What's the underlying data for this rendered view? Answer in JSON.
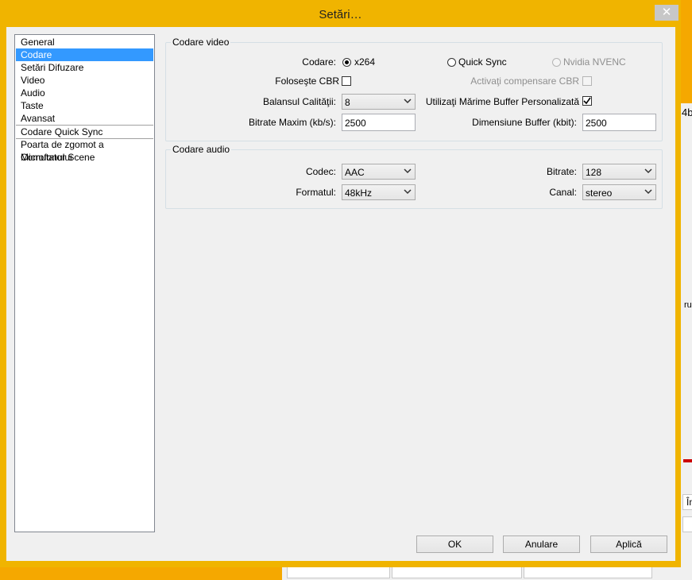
{
  "window": {
    "title": "Setări…",
    "close_glyph": "✕"
  },
  "nav": {
    "items": [
      {
        "label": "General"
      },
      {
        "label": "Codare"
      },
      {
        "label": "Setări Difuzare"
      },
      {
        "label": "Video"
      },
      {
        "label": "Audio"
      },
      {
        "label": "Taste"
      },
      {
        "label": "Avansat"
      },
      {
        "label": "Codare Quick Sync"
      },
      {
        "label": "Poarta de zgomot a Microfonului"
      },
      {
        "label": "Comutator Scene"
      }
    ],
    "selected": "Codare"
  },
  "video": {
    "title": "Codare video",
    "encoder_label": "Codare:",
    "encoder_options": [
      {
        "label": "x264",
        "checked": true,
        "enabled": true
      },
      {
        "label": "Quick Sync",
        "checked": false,
        "enabled": true
      },
      {
        "label": "Nvidia NVENC",
        "checked": false,
        "enabled": false
      }
    ],
    "cbr_label": "Foloseşte CBR",
    "cbr_checked": false,
    "padding_label": "Activaţi compensare CBR",
    "padding_checked": false,
    "quality_label": "Balansul Calităţii:",
    "quality_value": "8",
    "custom_buffer_label": "Utilizaţi Mărime Buffer Personalizată",
    "custom_buffer_checked": true,
    "max_bitrate_label": "Bitrate Maxim (kb/s):",
    "max_bitrate_value": "2500",
    "buffer_size_label": "Dimensiune Buffer (kbit):",
    "buffer_size_value": "2500"
  },
  "audio": {
    "title": "Codare audio",
    "codec_label": "Codec:",
    "codec_value": "AAC",
    "bitrate_label": "Bitrate:",
    "bitrate_value": "128",
    "format_label": "Formatul:",
    "format_value": "48kHz",
    "channel_label": "Canal:",
    "channel_value": "stereo"
  },
  "buttons": {
    "ok": "OK",
    "cancel": "Anulare",
    "apply": "Aplică"
  },
  "background_fragments": [
    "4b",
    "ru",
    "În"
  ],
  "colors": {
    "frame": "#f0b400",
    "selection": "#3399ff"
  }
}
